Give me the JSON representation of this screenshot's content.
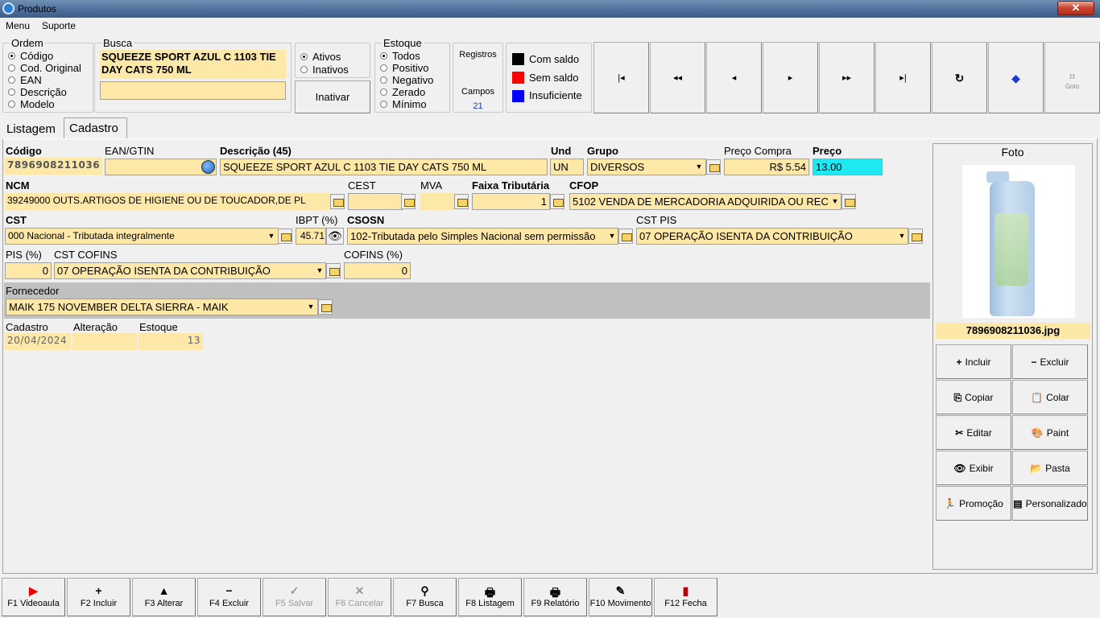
{
  "window": {
    "title": "Produtos",
    "close": "✕"
  },
  "menu": [
    "Menu",
    "Suporte"
  ],
  "ordem": {
    "title": "Ordem",
    "options": [
      "Código",
      "Cod. Original",
      "EAN",
      "Descrição",
      "Modelo"
    ],
    "selected": 0
  },
  "busca": {
    "title": "Busca",
    "text": "SQUEEZE SPORT AZUL C 1103 TIE DAY CATS 750 ML",
    "input": ""
  },
  "status": {
    "options": [
      "Ativos",
      "Inativos"
    ],
    "selected": 0,
    "button": "Inativar"
  },
  "estoque": {
    "title": "Estoque",
    "options": [
      "Todos",
      "Positivo",
      "Negativo",
      "Zerado",
      "Mínimo"
    ],
    "selected": 0
  },
  "info": {
    "registros_label": "Registros",
    "campos_label": "Campos",
    "campos_value": "21"
  },
  "legend": [
    {
      "label": "Com saldo",
      "color": "#000000"
    },
    {
      "label": "Sem saldo",
      "color": "#ff0000"
    },
    {
      "label": "Insuficiente",
      "color": "#0000ff"
    }
  ],
  "nav": [
    "first-icon",
    "rewind-icon",
    "prev-icon",
    "next-icon",
    "fast-forward-icon",
    "last-icon",
    "refresh-icon",
    "eraser-icon",
    "goto-icon"
  ],
  "nav_goto_label": "Goto",
  "tabs": [
    "Listagem",
    "Cadastro"
  ],
  "form": {
    "codigo_label": "Código",
    "codigo": "7896908211036",
    "ean_label": "EAN/GTIN",
    "ean": "",
    "descricao_label": "Descrição (45)",
    "descricao": "SQUEEZE SPORT AZUL C 1103 TIE DAY CATS 750 ML",
    "und_label": "Und",
    "und": "UN",
    "grupo_label": "Grupo",
    "grupo": "DIVERSOS",
    "preco_compra_label": "Preço Compra",
    "preco_compra": "R$ 5.54",
    "preco_label": "Preço",
    "preco": "13.00",
    "ncm_label": "NCM",
    "ncm": "39249000 OUTS.ARTIGOS DE HIGIENE OU DE TOUCADOR,DE PL",
    "cest_label": "CEST",
    "cest": "",
    "mva_label": "MVA",
    "mva": "",
    "faixa_label": "Faixa Tributária",
    "faixa": "1",
    "cfop_label": "CFOP",
    "cfop": "5102 VENDA DE MERCADORIA ADQUIRIDA OU REC",
    "cst_label": "CST",
    "cst": "000 Nacional - Tributada integralmente",
    "ibpt_label": "IBPT (%)",
    "ibpt": "45.71",
    "csosn_label": "CSOSN",
    "csosn": "102-Tributada pelo Simples Nacional sem permissão",
    "cst_pis_label": "CST PIS",
    "cst_pis": "07 OPERAÇÃO ISENTA DA CONTRIBUIÇÃO",
    "pis_label": "PIS (%)",
    "pis": "0",
    "cst_cofins_label": "CST COFINS",
    "cst_cofins": "07 OPERAÇÃO ISENTA DA CONTRIBUIÇÃO",
    "cofins_label": "COFINS (%)",
    "cofins": "0",
    "fornecedor_label": "Fornecedor",
    "fornecedor": "MAIK 175 NOVEMBER DELTA SIERRA - MAIK",
    "cadastro_label": "Cadastro",
    "cadastro": "20/04/2024",
    "alteracao_label": "Alteração",
    "alteracao": "",
    "estoque_label": "Estoque",
    "estoque": "13"
  },
  "foto": {
    "title": "Foto",
    "filename": "7896908211036.jpg"
  },
  "foto_buttons": [
    {
      "label": "Incluir",
      "icon": "plus-icon",
      "glyph": "+"
    },
    {
      "label": "Excluir",
      "icon": "minus-icon",
      "glyph": "−"
    },
    {
      "label": "Copiar",
      "icon": "copy-icon",
      "glyph": "⎘"
    },
    {
      "label": "Colar",
      "icon": "paste-icon",
      "glyph": "📋"
    },
    {
      "label": "Editar",
      "icon": "scissors-icon",
      "glyph": "✂"
    },
    {
      "label": "Paint",
      "icon": "palette-icon",
      "glyph": "🎨"
    },
    {
      "label": "Exibir",
      "icon": "eye-icon",
      "glyph": "👁"
    },
    {
      "label": "Pasta",
      "icon": "folder-icon",
      "glyph": "📂"
    },
    {
      "label": "Promoção",
      "icon": "runner-icon",
      "glyph": "🏃"
    },
    {
      "label": "Personalizado",
      "icon": "card-icon",
      "glyph": "▤"
    }
  ],
  "footer": [
    {
      "label": "F1 Videoaula",
      "icon": "youtube-icon",
      "glyph": "▶",
      "enabled": true
    },
    {
      "label": "F2 Incluir",
      "icon": "plus-icon",
      "glyph": "+",
      "enabled": true
    },
    {
      "label": "F3 Alterar",
      "icon": "up-arrow-icon",
      "glyph": "▲",
      "enabled": true
    },
    {
      "label": "F4 Excluir",
      "icon": "minus-icon",
      "glyph": "−",
      "enabled": true
    },
    {
      "label": "F5 Salvar",
      "icon": "check-icon",
      "glyph": "✓",
      "enabled": false
    },
    {
      "label": "F6 Cancelar",
      "icon": "x-icon",
      "glyph": "✕",
      "enabled": false
    },
    {
      "label": "F7 Busca",
      "icon": "binoculars-icon",
      "glyph": "⚲",
      "enabled": true
    },
    {
      "label": "F8 Listagem",
      "icon": "printer-icon",
      "glyph": "🖶",
      "enabled": true
    },
    {
      "label": "F9 Relatório",
      "icon": "printer-icon",
      "glyph": "🖶",
      "enabled": true
    },
    {
      "label": "F10 Movimento",
      "icon": "document-icon",
      "glyph": "✎",
      "enabled": true
    },
    {
      "label": "F12 Fecha",
      "icon": "exit-icon",
      "glyph": "▮",
      "enabled": true
    }
  ]
}
